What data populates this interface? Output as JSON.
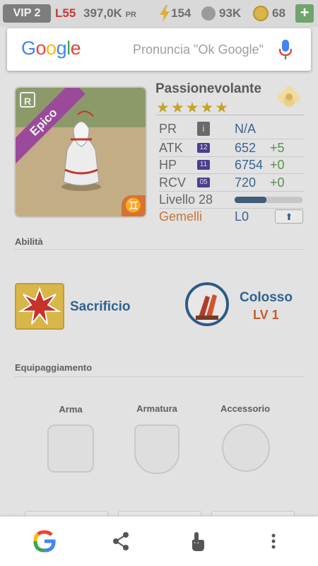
{
  "top_bar": {
    "vip": "VIP 2",
    "level": "L55",
    "pr_value": "397,0K",
    "pr_suffix": "PR",
    "energy": "154",
    "paw": "93K",
    "coins": "68",
    "plus": "+"
  },
  "google_bar": {
    "logo": "Google",
    "placeholder": "Pronuncia \"Ok Google\""
  },
  "hero": {
    "name": "Passionevolante",
    "rarity": "Epico",
    "rarity_badge": "R",
    "stars_text": "★★★★★",
    "stars": 5,
    "stats": [
      {
        "label": "PR",
        "badge": "i",
        "value": "N/A",
        "bonus": ""
      },
      {
        "label": "ATK",
        "badge": "12",
        "value": "652",
        "bonus": "+5"
      },
      {
        "label": "HP",
        "badge": "11",
        "value": "6754",
        "bonus": "+0"
      },
      {
        "label": "RCV",
        "badge": "05",
        "value": "720",
        "bonus": "+0"
      }
    ],
    "level_label": "Livello 28",
    "level_progress": 0.47,
    "sign": "Gemelli",
    "sign_glyph": "♊",
    "sign_level": "L0",
    "upgrade_arrow": "⬆"
  },
  "abilities": {
    "title": "Abilità",
    "skill_1": {
      "name": "Sacrificio"
    },
    "skill_2": {
      "name": "Colosso",
      "level": "LV 1"
    }
  },
  "equipment": {
    "title": "Equipaggiamento",
    "slots": [
      "Arma",
      "Armatura",
      "Accessorio"
    ]
  },
  "colors": {
    "accent_blue": "#2f6391",
    "bonus_green": "#59904e",
    "sign_orange": "#c97536",
    "rarity_purple": "#9b4a9b"
  },
  "icons": [
    "google-g-icon",
    "share-icon",
    "touch-icon",
    "more-vert-icon",
    "microphone-icon"
  ]
}
